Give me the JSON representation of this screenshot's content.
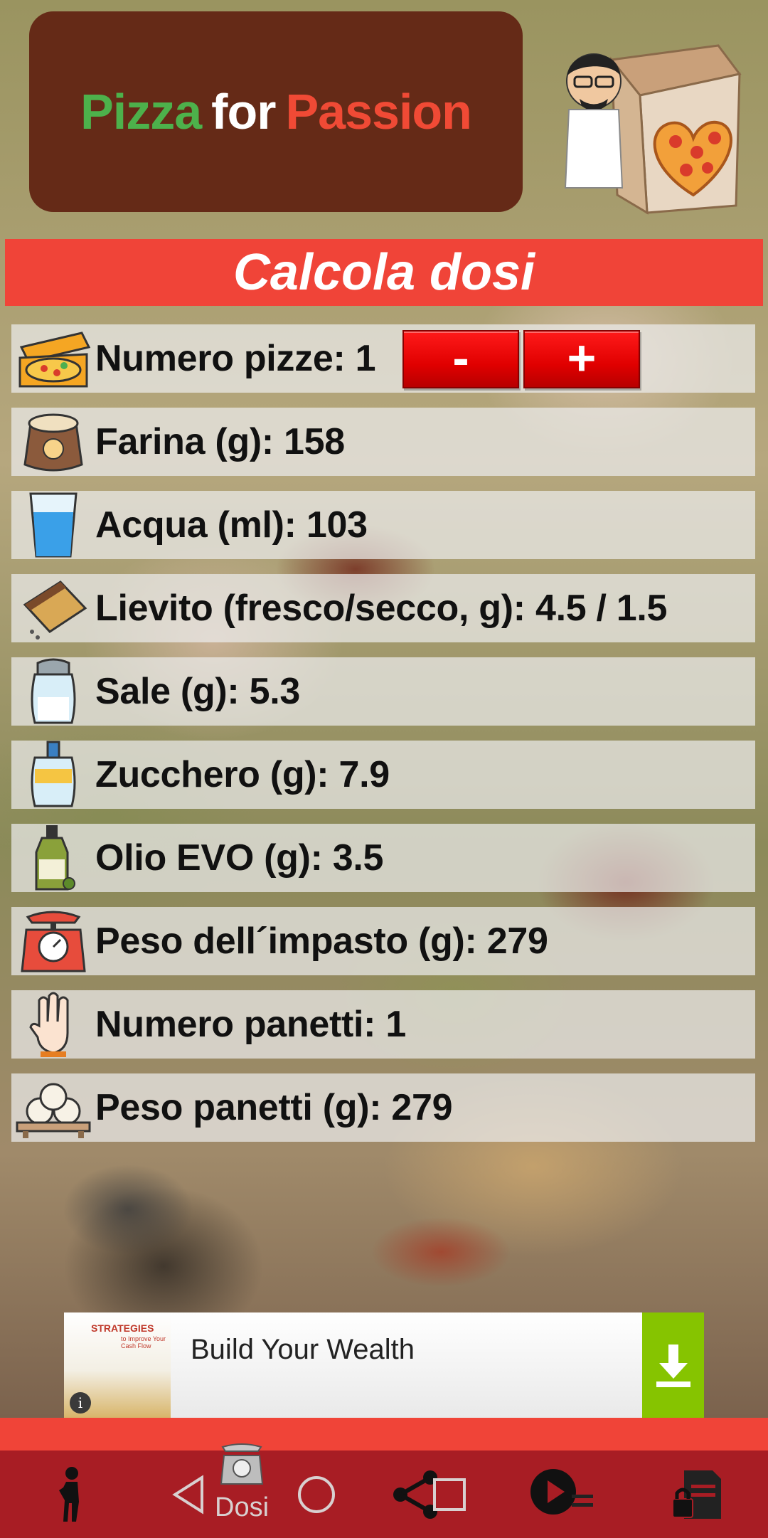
{
  "header": {
    "title_part1": "Pizza",
    "title_part2": "for",
    "title_part3": "Passion",
    "colors": {
      "part1": "#4db14b",
      "part2": "#ffffff",
      "part3": "#f04a35",
      "box": "#652a17"
    }
  },
  "mascot": {
    "icon": "chef-pizza-box-icon"
  },
  "section_title": "Calcola dosi",
  "rows": [
    {
      "icon": "pizza-box-icon",
      "label": "Numero pizze: 1"
    },
    {
      "icon": "flour-sack-icon",
      "label": "Farina (g): 158"
    },
    {
      "icon": "water-glass-icon",
      "label": "Acqua (ml): 103"
    },
    {
      "icon": "yeast-packet-icon",
      "label": "Lievito (fresco/secco, g): 4.5 / 1.5"
    },
    {
      "icon": "salt-shaker-icon",
      "label": "Sale (g): 5.3"
    },
    {
      "icon": "sugar-jar-icon",
      "label": "Zucchero (g): 7.9"
    },
    {
      "icon": "olive-oil-icon",
      "label": "Olio EVO (g): 3.5"
    },
    {
      "icon": "kitchen-scale-icon",
      "label": "Peso dell´impasto (g): 279"
    },
    {
      "icon": "hand-count-icon",
      "label": "Numero panetti: 1"
    },
    {
      "icon": "dough-balls-icon",
      "label": "Peso panetti (g): 279"
    }
  ],
  "buttons": {
    "minus": "-",
    "plus": "+"
  },
  "ad": {
    "headline": "Build Your Wealth",
    "thumb_title": "STRATEGIES",
    "thumb_sub": "to Improve Your Cash Flow",
    "info": "i"
  },
  "bottom_nav": {
    "dosi_label": "Dosi",
    "items": [
      "person-icon",
      "scale-icon",
      "share-icon",
      "play-list-icon",
      "document-lock-icon"
    ]
  },
  "system_nav": [
    "back-icon",
    "home-icon",
    "recents-icon"
  ],
  "colors": {
    "accent": "#f04438",
    "nav": "#a81d24",
    "download": "#86c400"
  }
}
